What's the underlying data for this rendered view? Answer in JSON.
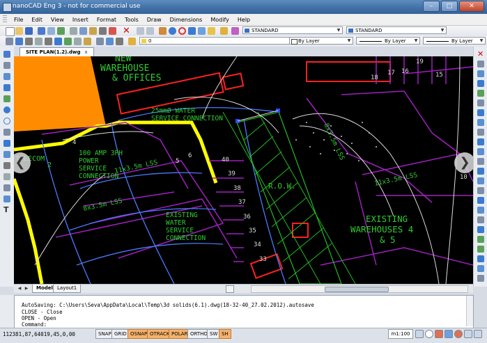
{
  "window": {
    "title": "nanoCAD Eng 3 - not for commercial use",
    "buttons": {
      "minimize": "–",
      "maximize": "□",
      "close": "✕"
    }
  },
  "menu": [
    "File",
    "Edit",
    "View",
    "Insert",
    "Format",
    "Tools",
    "Draw",
    "Dimensions",
    "Modify",
    "Help"
  ],
  "toolbar": {
    "text_style": "STANDARD",
    "dim_style": "STANDARD",
    "layer": "0",
    "color": "By Layer",
    "linetype": "By Layer",
    "lineweight": "By Layer"
  },
  "document_tab": {
    "label": "SITE PLAN(1.2).dwg",
    "close": "x"
  },
  "drawing_text": {
    "new_warehouse_1": "NEW",
    "new_warehouse_2": "WAREHOUSE",
    "new_warehouse_3": "& OFFICES",
    "water_1": "25mmØ WATER",
    "water_2": "SERVICE CONNECTION",
    "power_1": "100 AMP 3PH",
    "power_2": "POWER",
    "power_3": "SERVICE",
    "power_4": "CONNECTION",
    "telecom_1": "TELECOM",
    "telecom_2": "2",
    "lss_1": "11x3.5m LSS",
    "lss_2": "8x3.5m LSS",
    "lss_3": "8x3.5m LSS",
    "lss_4": "11x3.5m LSS",
    "existing_water_1": "EXISTING",
    "existing_water_2": "WATER",
    "existing_water_3": "SERVICE",
    "existing_water_4": "CONNECTION",
    "row": "R.O.W.",
    "existing_wh_1": "EXISTING",
    "existing_wh_2": "WAREHOUSES 4",
    "existing_wh_3": "& 5",
    "n4": "4",
    "n5": "5",
    "n6": "6",
    "n40": "40",
    "n39": "39",
    "n38": "38",
    "n37": "37",
    "n36": "36",
    "n35": "35",
    "n34": "34",
    "n33": "33",
    "n15": "15",
    "n16": "16",
    "n17": "17",
    "n18": "18",
    "n19": "19",
    "n10": "10"
  },
  "layout_tabs": [
    "Model",
    "Layout1"
  ],
  "command_history": [
    "AutoSaving: C:\\Users\\Seva\\AppData\\Local\\Temp\\3d solids(6.1).dwg(18-32-40_27.02.2012).autosave",
    "CLOSE - Close",
    "OPEN - Open"
  ],
  "command_prompt": "Command:",
  "status": {
    "coordinates": "112381,87,64019,45,0,00",
    "toggles": [
      {
        "label": "SNAP",
        "on": false
      },
      {
        "label": "GRID",
        "on": false
      },
      {
        "label": "OSNAP",
        "on": true
      },
      {
        "label": "OTRACK",
        "on": true
      },
      {
        "label": "POLAR",
        "on": true
      },
      {
        "label": "ORTHO",
        "on": false
      },
      {
        "label": "SW",
        "on": false
      },
      {
        "label": "SH",
        "on": true
      }
    ],
    "scale": "m1:100"
  },
  "colors": {
    "canvas": "#000000",
    "orange_fill": "#ff8c00",
    "yellow_boundary": "#ffff00",
    "green_text": "#2ecc2e",
    "red_lines": "#ff2020",
    "purple_lines": "#a020c0",
    "blue_lines": "#4a7bff",
    "status_on": "#f6b26b"
  }
}
